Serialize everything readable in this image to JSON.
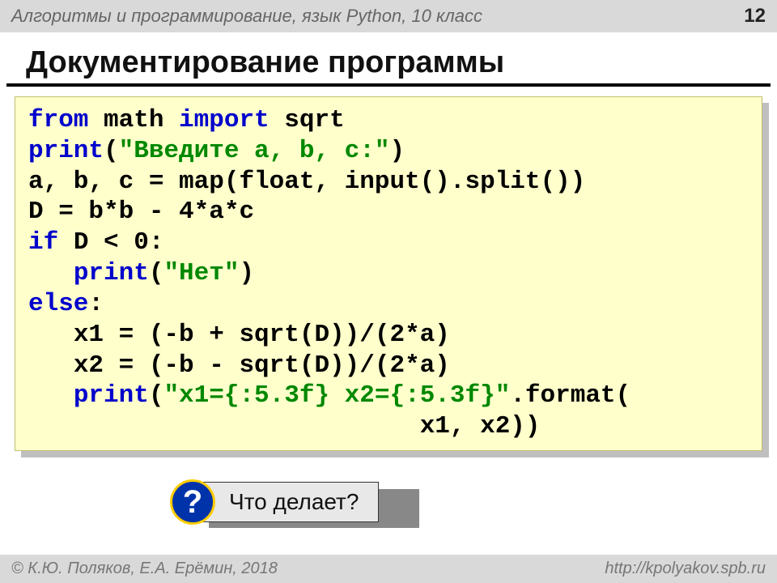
{
  "header": {
    "course": "Алгоритмы и программирование, язык Python, 10 класс",
    "page_number": "12"
  },
  "title": "Документирование программы",
  "code": {
    "l1_kw_from": "from",
    "l1_mod": " math ",
    "l1_kw_import": "import",
    "l1_sqrt": " sqrt",
    "l2_print": "print",
    "l2_paren": "(",
    "l2_str": "\"Введите a, b, c:\"",
    "l2_close": ")",
    "l3": "a, b, c = map(float, input().split())",
    "l4": "D = b*b - 4*a*c",
    "l5_if": "if",
    "l5_rest": " D < 0:",
    "l6_indent": "   ",
    "l6_print": "print",
    "l6_paren": "(",
    "l6_str": "\"Нет\"",
    "l6_close": ")",
    "l7_else": "else",
    "l7_colon": ":",
    "l8_indent": "   ",
    "l8": "x1 = (-b + sqrt(D))/(2*a)",
    "l9_indent": "   ",
    "l9": "x2 = (-b - sqrt(D))/(2*a)",
    "l10_indent": "   ",
    "l10_print": "print",
    "l10_paren": "(",
    "l10_str": "\"x1={:5.3f} x2={:5.3f}\"",
    "l10_fmt": ".format(",
    "l11_indent": "                          ",
    "l11": "x1, x2))"
  },
  "callout": {
    "mark": "?",
    "text": "Что делает?"
  },
  "footer": {
    "left": "© К.Ю. Поляков, Е.А. Ерёмин, 2018",
    "right": "http://kpolyakov.spb.ru"
  }
}
